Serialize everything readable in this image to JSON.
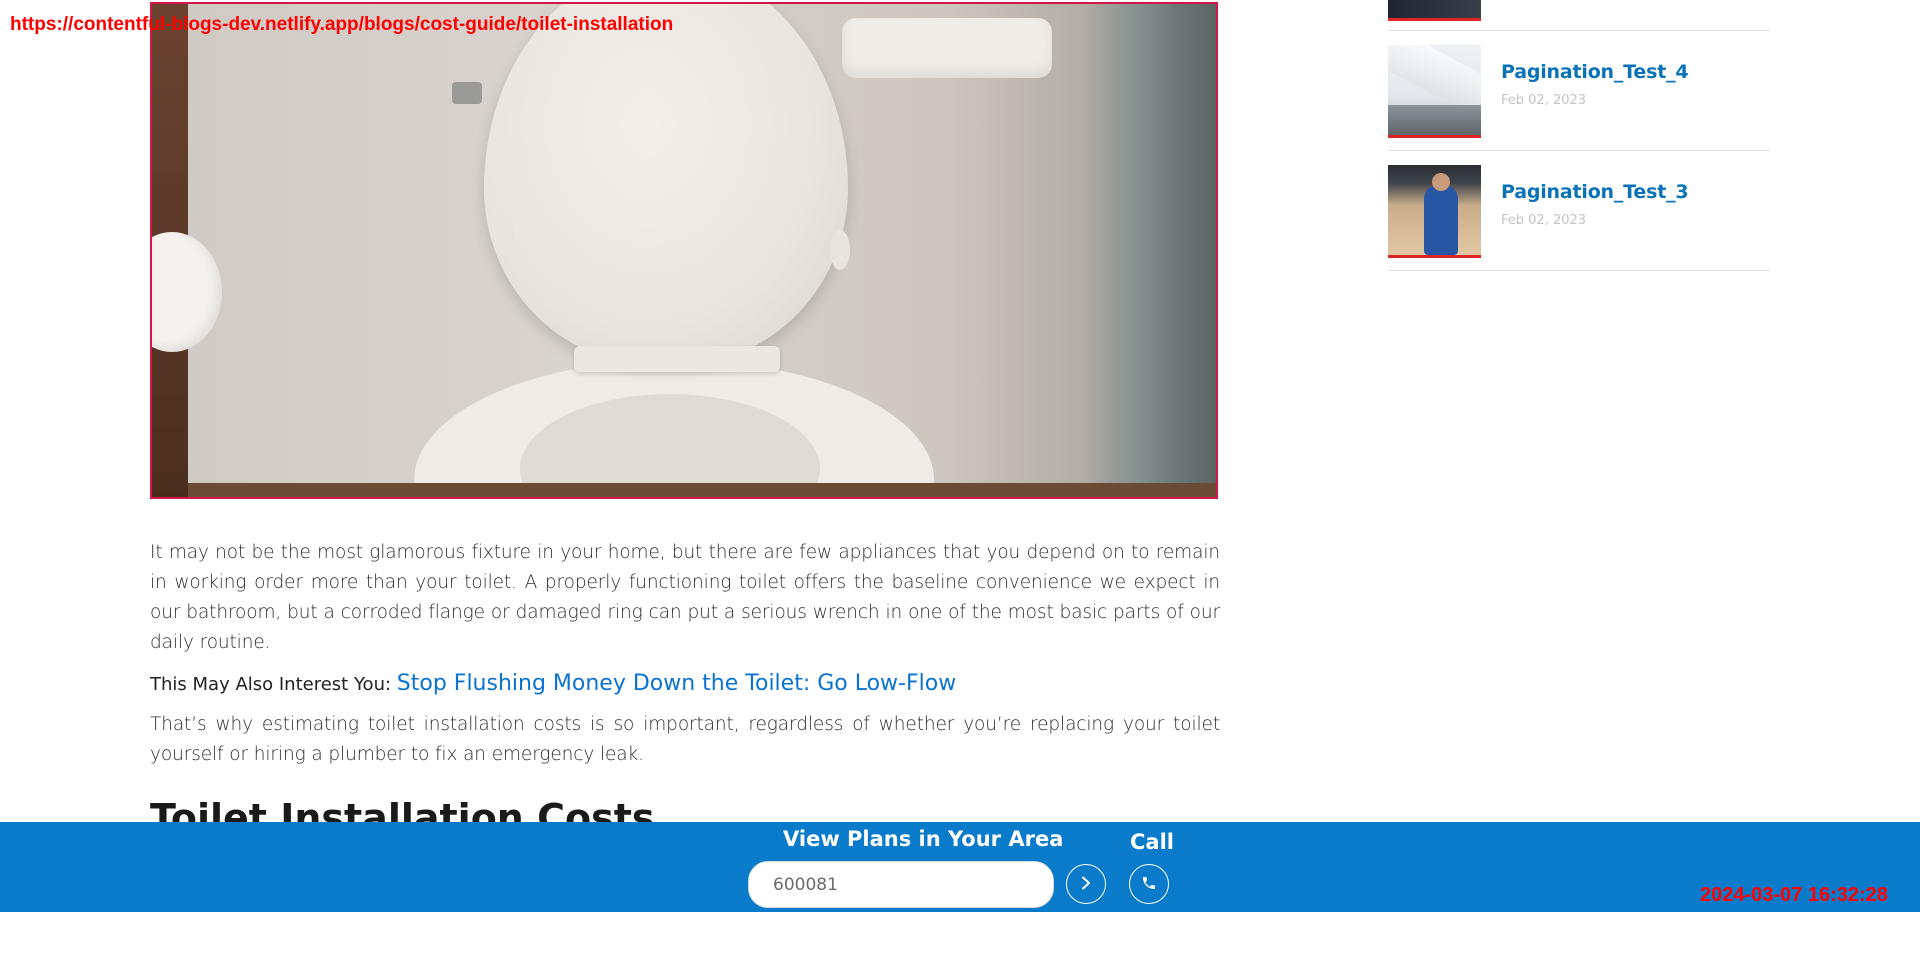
{
  "overlay": {
    "url": "https://contentful-blogs-dev.netlify.app/blogs/cost-guide/toilet-installation",
    "timestamp": "2024-03-07 16:32:28"
  },
  "article": {
    "paragraph_1": "It may not be the most glamorous fixture in your home, but there are few appliances that you depend on to remain in working order more than your toilet. A properly functioning toilet offers the baseline convenience we expect in our bathroom, but a corroded flange or damaged ring can put a serious wrench in one of the most basic parts of our daily routine.",
    "also_interest_label": "This May Also Interest You:",
    "also_interest_link": "Stop Flushing Money Down the Toilet: Go Low-Flow",
    "paragraph_2": "That’s why estimating toilet installation costs is so important, regardless of whether you’re replacing your toilet yourself or hiring a plumber to fix an emergency leak.",
    "heading": "Toilet Installation Costs"
  },
  "sidebar": {
    "items": [
      {
        "title": "Pagination_Test_4",
        "date": "Feb 02, 2023",
        "thumb_icon": "roof-gutter-photo"
      },
      {
        "title": "Pagination_Test_3",
        "date": "Feb 02, 2023",
        "thumb_icon": "technician-photo"
      }
    ]
  },
  "bottom_bar": {
    "title": "View Plans in Your Area",
    "zip_value": "600081",
    "call_label": "Call",
    "go_icon": "chevron-right-icon",
    "call_icon": "phone-icon"
  },
  "colors": {
    "accent_blue": "#0a7acb",
    "link_blue": "#0a73d4",
    "sidebar_title": "#0a73b8",
    "thumb_underline": "#e02424",
    "overlay_red": "#ff0000"
  }
}
